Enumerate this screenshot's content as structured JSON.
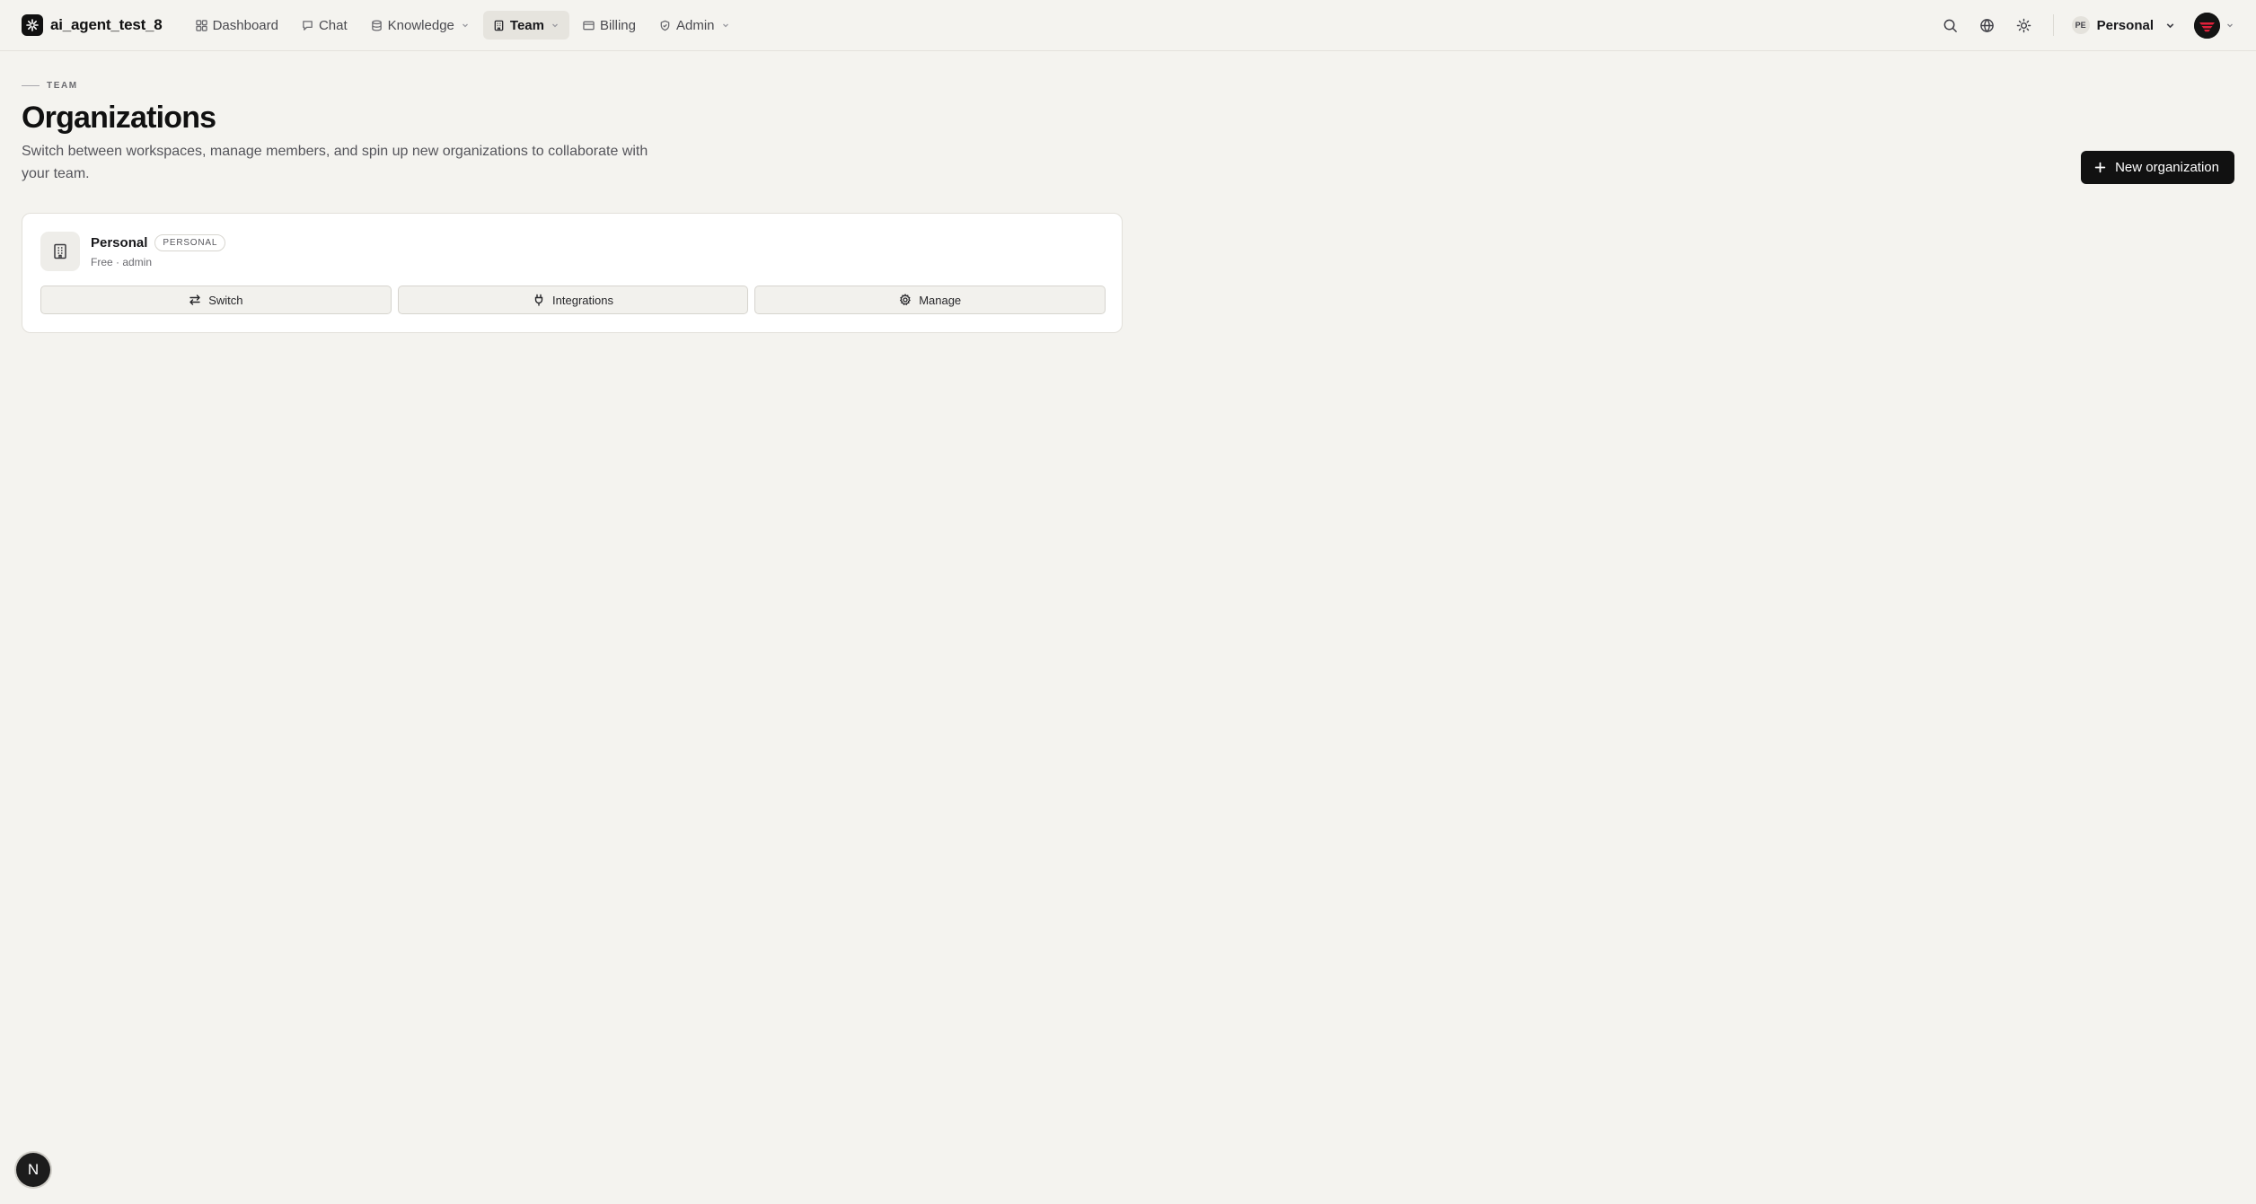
{
  "app": {
    "name": "ai_agent_test_8"
  },
  "nav": {
    "items": [
      {
        "label": "Dashboard",
        "icon": "grid-icon"
      },
      {
        "label": "Chat",
        "icon": "message-icon"
      },
      {
        "label": "Knowledge",
        "icon": "database-icon",
        "dropdown": true
      },
      {
        "label": "Team",
        "icon": "building-icon",
        "dropdown": true,
        "active": true
      },
      {
        "label": "Billing",
        "icon": "card-icon"
      },
      {
        "label": "Admin",
        "icon": "shield-icon",
        "dropdown": true
      }
    ]
  },
  "topbar": {
    "workspace_badge": "PE",
    "workspace_name": "Personal"
  },
  "page": {
    "eyebrow": "TEAM",
    "title": "Organizations",
    "description": "Switch between workspaces, manage members, and spin up new organizations to collaborate with your team.",
    "new_button": "New organization"
  },
  "organizations": [
    {
      "name": "Personal",
      "tag": "PERSONAL",
      "subtitle": "Free · admin",
      "actions": {
        "switch": "Switch",
        "integrations": "Integrations",
        "manage": "Manage"
      }
    }
  ],
  "floating_badge": "N",
  "colors": {
    "accent": "#111111",
    "background": "#f4f3ef",
    "card": "#ffffff",
    "avatar_accent": "#e0203a"
  }
}
